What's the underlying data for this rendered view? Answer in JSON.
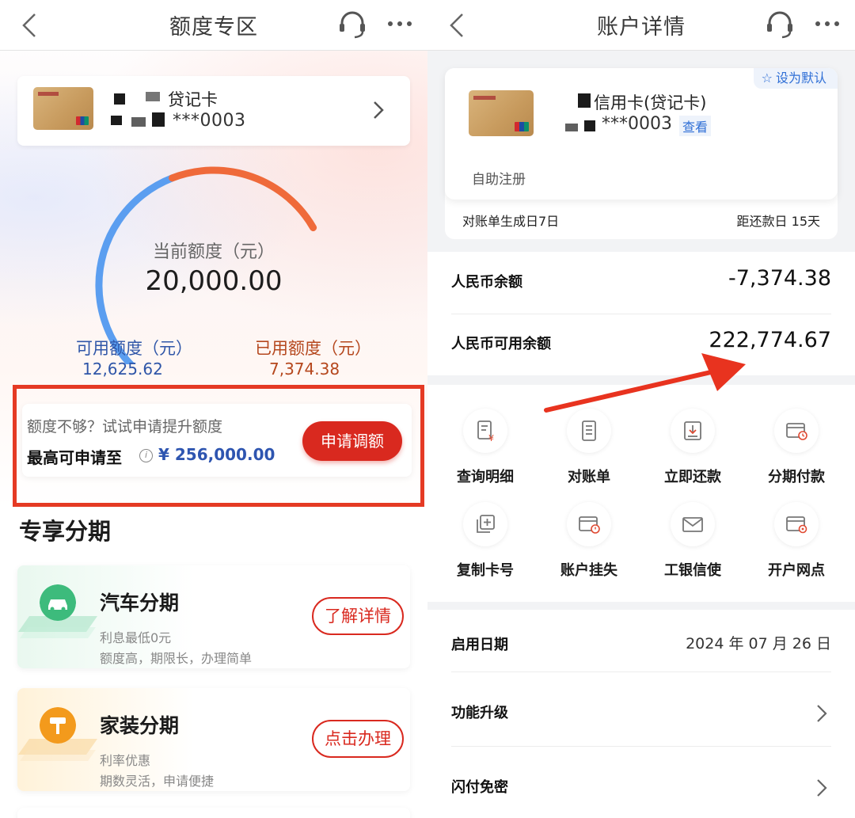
{
  "left": {
    "nav": {
      "title": "额度专区"
    },
    "card": {
      "name": "贷记卡",
      "number": "***0003"
    },
    "gauge": {
      "current_label": "当前额度（元）",
      "current_value": "20,000.00",
      "available_label": "可用额度（元）",
      "available_value": "12,625.62",
      "used_label": "已用额度（元）",
      "used_value": "7,374.38",
      "used_fraction": 0.369,
      "colors": {
        "available": "#5b9ef0",
        "used": "#ef6a3a"
      }
    },
    "promo": {
      "question": "额度不够？试试申请提升额度",
      "max_label": "最高可申请至",
      "info_icon": "i",
      "max_amount": "¥ 256,000.00",
      "button": "申请调额",
      "highlight_color": "#e53a24"
    },
    "section_title": "专享分期",
    "offers": [
      {
        "title": "汽车分期",
        "line1": "利息最低0元",
        "line2": "额度高，期限长，办理简单",
        "cta": "了解详情",
        "icon": "car-icon"
      },
      {
        "title": "家装分期",
        "line1": "利率优惠",
        "line2": "期数灵活，申请便捷",
        "cta": "点击办理",
        "icon": "paint-roller-icon"
      }
    ]
  },
  "right": {
    "nav": {
      "title": "账户详情"
    },
    "card": {
      "default_tag": "设为默认",
      "name": "信用卡(贷记卡)",
      "number": "***0003",
      "view": "查看",
      "self_register": "自助注册",
      "bill_day": "对账单生成日7日",
      "due_day": "距还款日 15天"
    },
    "balances": [
      {
        "label": "人民币余额",
        "value": "-7,374.38"
      },
      {
        "label": "人民币可用余额",
        "value": "222,774.67"
      }
    ],
    "actions": [
      {
        "label": "查询明细",
        "icon": "statement-yuan-icon"
      },
      {
        "label": "对账单",
        "icon": "bill-icon"
      },
      {
        "label": "立即还款",
        "icon": "repay-download-icon"
      },
      {
        "label": "分期付款",
        "icon": "card-clock-icon"
      },
      {
        "label": "复制卡号",
        "icon": "copy-icon"
      },
      {
        "label": "账户挂失",
        "icon": "card-alert-icon"
      },
      {
        "label": "工银信使",
        "icon": "envelope-icon"
      },
      {
        "label": "开户网点",
        "icon": "card-location-icon"
      }
    ],
    "info": [
      {
        "label": "启用日期",
        "value": "2024 年 07 月 26 日"
      },
      {
        "label": "功能升级",
        "value": ""
      },
      {
        "label": "闪付免密",
        "value": ""
      }
    ]
  },
  "annotation": {
    "arrow_color": "#e8331f"
  }
}
